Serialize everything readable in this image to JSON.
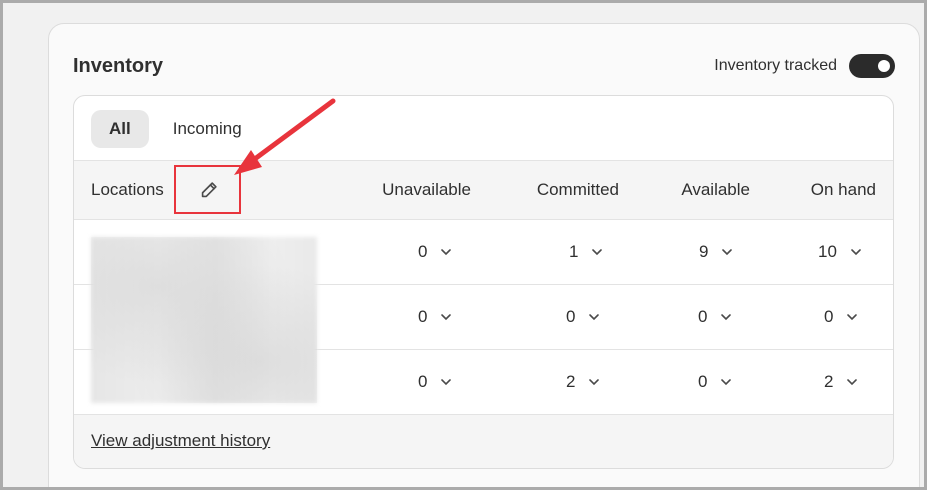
{
  "card": {
    "title": "Inventory",
    "tracked_label": "Inventory tracked",
    "tracked_on": true
  },
  "tabs": [
    {
      "label": "All",
      "active": true
    },
    {
      "label": "Incoming",
      "active": false
    }
  ],
  "table": {
    "columns": [
      "Locations",
      "Unavailable",
      "Committed",
      "Available",
      "On hand"
    ],
    "rows": [
      {
        "unavailable": "0",
        "committed": "1",
        "available": "9",
        "on_hand": "10"
      },
      {
        "unavailable": "0",
        "committed": "0",
        "available": "0",
        "on_hand": "0"
      },
      {
        "unavailable": "0",
        "committed": "2",
        "available": "0",
        "on_hand": "2"
      }
    ]
  },
  "footer": {
    "history_link": "View adjustment history"
  },
  "colors": {
    "annotation": "#e8343c",
    "toggle_on": "#2b2b2b"
  },
  "icons": {
    "edit": "pencil-icon",
    "dropdown": "chevron-down-icon"
  }
}
